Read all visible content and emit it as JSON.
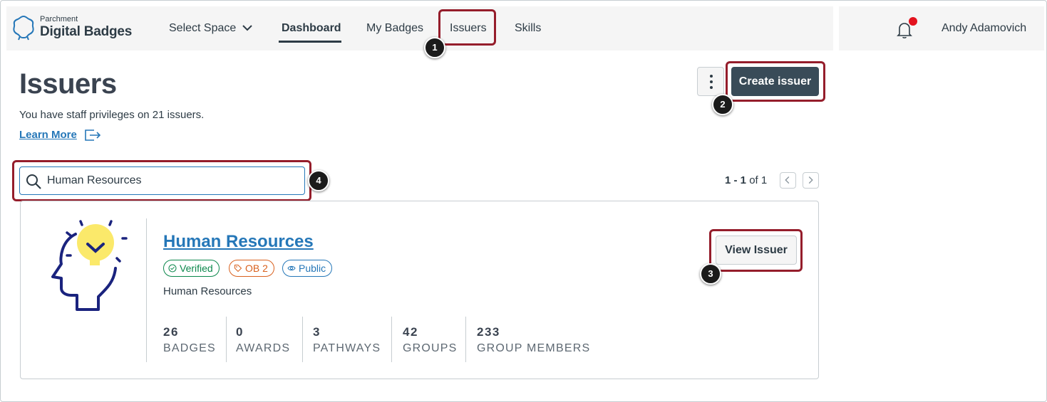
{
  "nav": {
    "logo_small": "Parchment",
    "logo_big": "Digital Badges",
    "select_space": "Select Space",
    "dashboard": "Dashboard",
    "my_badges": "My Badges",
    "issuers": "Issuers",
    "skills": "Skills",
    "user_name": "Andy Adamovich",
    "notification_dot_color": "#e3121e"
  },
  "header": {
    "title": "Issuers",
    "subtitle": "You have staff privileges on 21 issuers.",
    "learn_more": "Learn More",
    "create_issuer": "Create issuer"
  },
  "search": {
    "value": "Human Resources"
  },
  "pagination": {
    "range": "1 - 1",
    "of_label": "of 1"
  },
  "issuer_card": {
    "name": "Human Resources",
    "description": "Human Resources",
    "badges": [
      {
        "label": "Verified",
        "icon": "check-circle-icon",
        "color": "#0b874b"
      },
      {
        "label": "OB 2",
        "icon": "tag-icon",
        "color": "#d9611e"
      },
      {
        "label": "Public",
        "icon": "eye-icon",
        "color": "#2577b8"
      }
    ],
    "stats": [
      {
        "value": "26",
        "label": "BADGES"
      },
      {
        "value": "0",
        "label": "AWARDS"
      },
      {
        "value": "3",
        "label": "PATHWAYS"
      },
      {
        "value": "42",
        "label": "GROUPS"
      },
      {
        "value": "233",
        "label": "GROUP MEMBERS"
      }
    ],
    "view_issuer": "View Issuer"
  },
  "callouts": [
    "1",
    "2",
    "3",
    "4"
  ],
  "colors": {
    "accent": "#2577b8",
    "primary_button": "#394b58",
    "callout_border": "#951d2b"
  }
}
